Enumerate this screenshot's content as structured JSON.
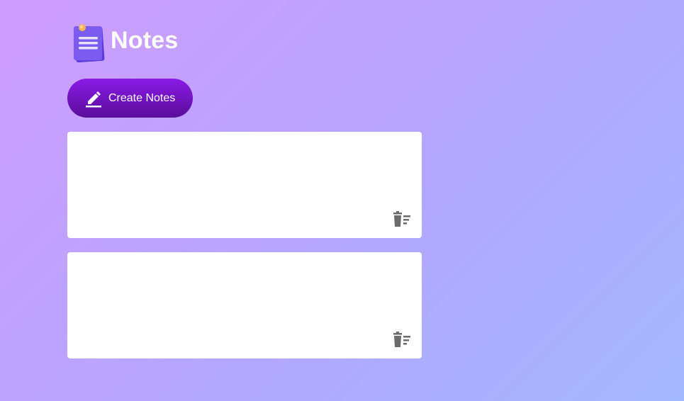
{
  "header": {
    "title": "Notes",
    "logo_icon": "notes-logo-icon"
  },
  "create_button": {
    "label": "Create Notes",
    "icon": "pencil-icon"
  },
  "notes": [
    {
      "text": "",
      "delete_icon": "delete-icon"
    },
    {
      "text": "",
      "delete_icon": "delete-icon"
    }
  ],
  "colors": {
    "background_start": "#cf9cff",
    "background_end": "#a3b8ff",
    "button_top": "#8a1ae6",
    "button_bottom": "#5a0d9a",
    "note_background": "#ffffff",
    "icon_gray": "#6b6b6b"
  }
}
